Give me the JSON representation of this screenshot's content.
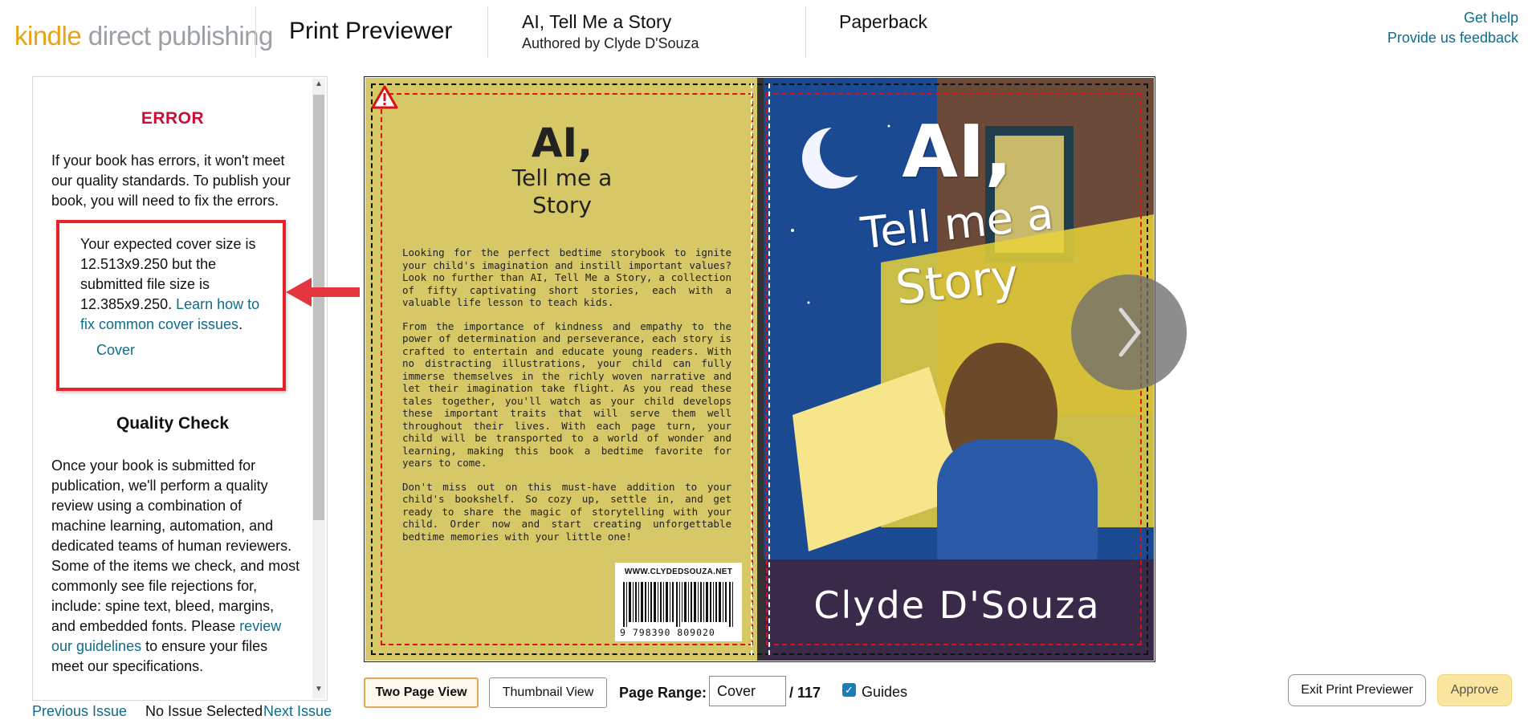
{
  "header": {
    "logo_kindle": "kindle",
    "logo_rest": "direct publishing",
    "app_title": "Print Previewer",
    "book_title": "AI, Tell Me a Story",
    "book_author": "Authored by Clyde D'Souza",
    "format": "Paperback",
    "get_help": "Get help",
    "feedback": "Provide us feedback"
  },
  "panel": {
    "error_title": "ERROR",
    "error_intro": "If your book has errors, it won't meet our quality standards. To publish your book, you will need to fix the errors.",
    "issue_text": "Your expected cover size is 12.513x9.250 but the submitted file size is 12.385x9.250.",
    "issue_link": "Learn how to fix common cover issues",
    "issue_link_suffix": ".",
    "issue_location": "Cover",
    "qc_title": "Quality Check",
    "qc_text": "Once your book is submitted for publication, we'll perform a quality review using a combination of machine learning, automation, and dedicated teams of human reviewers. Some of the items we check, and most commonly see file rejections for, include: spine text, bleed, margins, and embedded fonts. Please",
    "qc_link": "review our guidelines",
    "qc_text_end": "to ensure your files meet our specifications."
  },
  "issue_nav": {
    "previous": "Previous Issue",
    "status": "No Issue Selected",
    "next": "Next Issue"
  },
  "cover": {
    "back_title_1": "AI,",
    "back_title_2": "Tell me a",
    "back_title_3": "Story",
    "blurb_1": "Looking for the perfect bedtime storybook to ignite your child's imagination and instill important values? Look no further than AI, Tell Me a Story, a collection of fifty captivating short stories, each with a valuable life lesson to teach kids.",
    "blurb_2": "From the importance of kindness and empathy to the power of determination and perseverance, each story is crafted to entertain and educate young readers. With no distracting illustrations, your child can fully immerse themselves in the richly woven narrative and let their imagination take flight. As you read these tales together, you'll watch as your child develops these important traits that will serve them well throughout their lives. With each page turn, your child will be transported to a world of wonder and learning, making this book a bedtime favorite for years to come.",
    "blurb_3": "Don't miss out on this must-have addition to your child's bookshelf. So cozy up, settle in, and get ready to share the magic of storytelling with your child. Order now and start creating unforgettable bedtime memories with your little one!",
    "barcode_url": "WWW.CLYDEDSOUZA.NET",
    "barcode_number": "9  798390   809020",
    "front_title_1": "AI,",
    "front_title_2": "Tell me a",
    "front_title_3": "Story",
    "front_author": "Clyde D'Souza"
  },
  "toolbar": {
    "two_page": "Two Page View",
    "thumbnail": "Thumbnail View",
    "page_range_label": "Page Range:",
    "page_range_value": "Cover",
    "page_total": "/ 117",
    "guides_label": "Guides",
    "exit": "Exit Print Previewer",
    "approve": "Approve"
  },
  "colors": {
    "error_red": "#cc0c39",
    "link": "#0f6c8a",
    "approve_bg": "#fbe69f",
    "selected_border": "#e3a857",
    "back_cover": "#d6c867"
  }
}
